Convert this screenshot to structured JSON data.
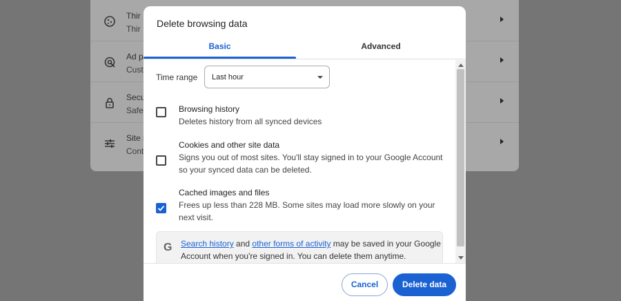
{
  "background_settings": {
    "rows": [
      {
        "icon": "cookie-icon",
        "title": "Thir",
        "subtitle": "Thir"
      },
      {
        "icon": "ad-privacy-icon",
        "title": "Ad p",
        "subtitle": "Cust"
      },
      {
        "icon": "lock-icon",
        "title": "Secu",
        "subtitle": "Safe"
      },
      {
        "icon": "tune-icon",
        "title": "Site s",
        "subtitle": "Cont"
      }
    ]
  },
  "dialog": {
    "title": "Delete browsing data",
    "tabs": {
      "basic": "Basic",
      "advanced": "Advanced"
    },
    "active_tab": "Basic",
    "time_range": {
      "label": "Time range",
      "value": "Last hour"
    },
    "options": [
      {
        "title": "Browsing history",
        "description": "Deletes history from all synced devices",
        "checked": false
      },
      {
        "title": "Cookies and other site data",
        "description": "Signs you out of most sites. You'll stay signed in to your Google Account so your synced data can be deleted.",
        "checked": false
      },
      {
        "title": "Cached images and files",
        "description": "Frees up less than 228 MB. Some sites may load more slowly on your next visit.",
        "checked": true
      }
    ],
    "google_notice": {
      "link1": "Search history",
      "middle": " and ",
      "link2": "other forms of activity",
      "rest": " may be saved in your Google Account when you're signed in. You can delete them anytime."
    },
    "buttons": {
      "cancel": "Cancel",
      "delete": "Delete data"
    }
  },
  "colors": {
    "accent": "#1a62d2",
    "scrim": "#757575"
  }
}
